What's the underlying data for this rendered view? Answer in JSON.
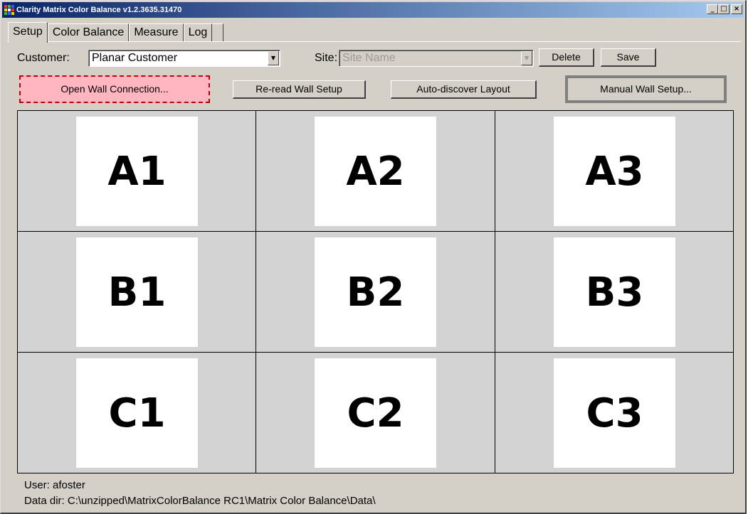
{
  "window": {
    "title": "Clarity Matrix Color Balance v1.2.3635.31470",
    "minimize": "_",
    "maximize": "□",
    "close": "×"
  },
  "tabs": [
    "Setup",
    "Color Balance",
    "Measure",
    "Log"
  ],
  "active_tab": "Setup",
  "customer": {
    "label": "Customer:",
    "value": "Planar Customer"
  },
  "site": {
    "label": "Site:",
    "value": "Site Name",
    "disabled": true
  },
  "buttons": {
    "delete": "Delete",
    "save": "Save",
    "open_wall": "Open Wall Connection...",
    "reread": "Re-read Wall Setup",
    "autodiscover": "Auto-discover Layout",
    "manual": "Manual Wall Setup..."
  },
  "wall": {
    "rows": [
      [
        "A1",
        "A2",
        "A3"
      ],
      [
        "B1",
        "B2",
        "B3"
      ],
      [
        "C1",
        "C2",
        "C3"
      ]
    ]
  },
  "status": {
    "user": "User: afoster",
    "data_dir": "Data dir: C:\\unzipped\\MatrixColorBalance RC1\\Matrix Color Balance\\Data\\"
  },
  "colors": {
    "open_wall_bg": "#ffb6c1",
    "open_wall_border": "#c00000",
    "titlebar_start": "#0a246a",
    "titlebar_end": "#a6caf0"
  }
}
